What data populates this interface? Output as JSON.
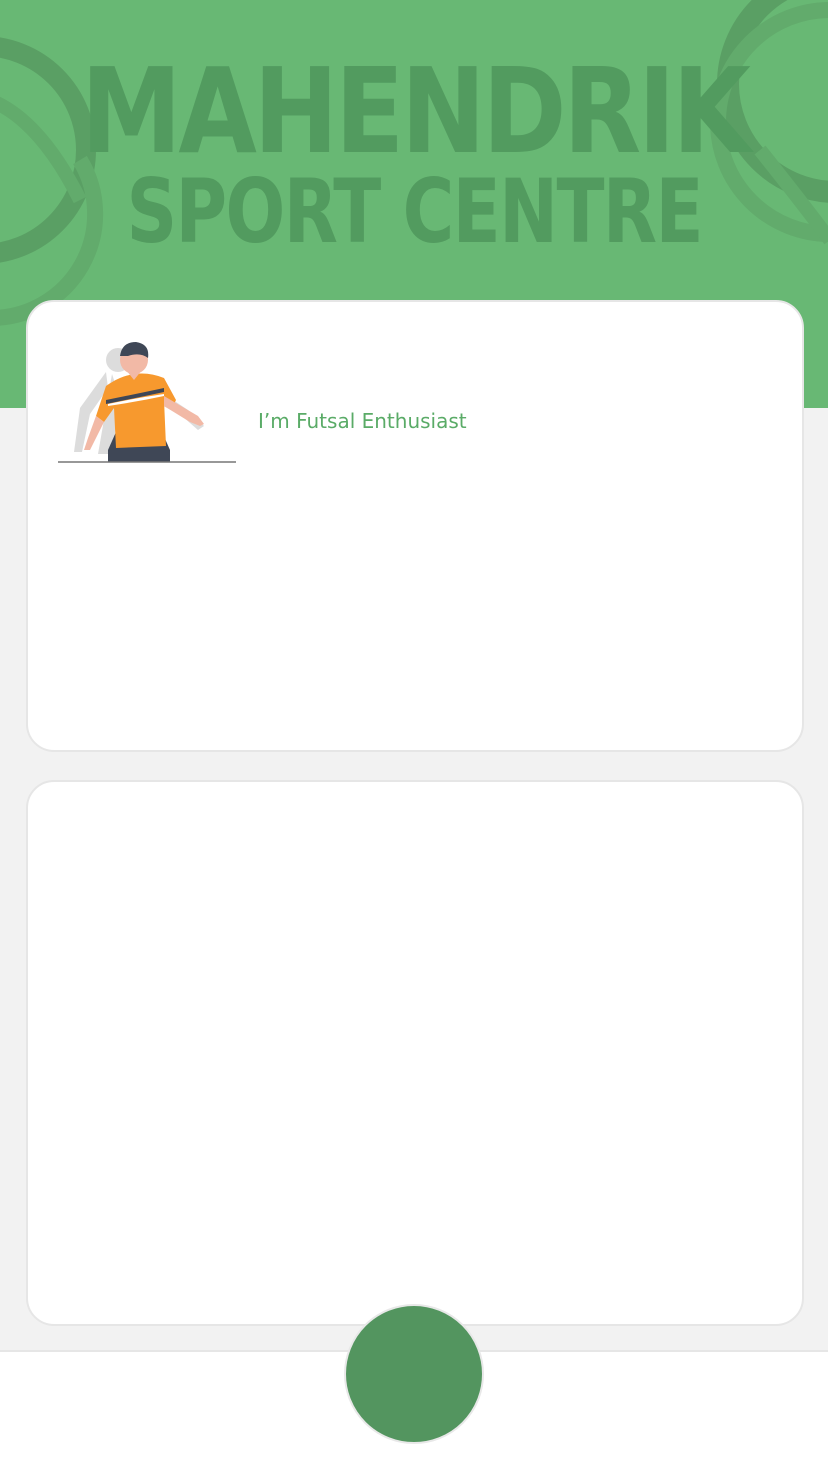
{
  "colors": {
    "header_bg": "#68b874",
    "header_decor": "#57a062",
    "brand_text": "#529b5f",
    "tagline": "#5aab67",
    "action_button": "#53955f",
    "page_bg": "#f2f2f2"
  },
  "header": {
    "title": "MAHENDRIK",
    "subtitle": "SPORT CENTRE"
  },
  "profile_card": {
    "illustration": "futsal-player-illustration",
    "tagline": "I’m Futsal Enthusiast"
  },
  "bottom_bar": {
    "action_button_icon": "none"
  }
}
